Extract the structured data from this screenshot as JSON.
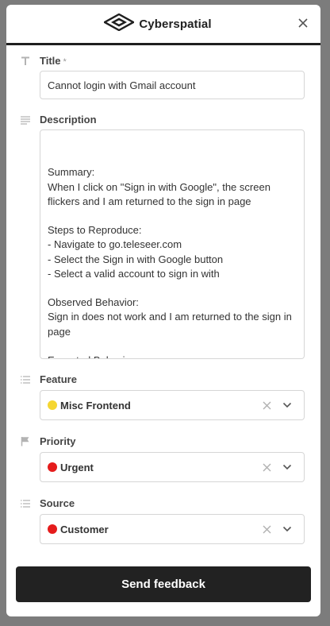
{
  "header": {
    "brand_name": "Cyberspatial"
  },
  "title_field": {
    "label": "Title",
    "required_mark": "*",
    "value": "Cannot login with Gmail account"
  },
  "description_field": {
    "label": "Description",
    "value": "Summary:\nWhen I click on \"Sign in with Google\", the screen flickers and I am returned to the sign in page\n\nSteps to Reproduce:\n- Navigate to go.teleseer.com\n- Select the Sign in with Google button\n- Select a valid account to sign in with\n\nObserved Behavior:\nSign in does not work and I am returned to the sign in page\n\nExpected Behavior:\nSign in works and the application loads"
  },
  "feature_field": {
    "label": "Feature",
    "value": "Misc Frontend",
    "color": "#f5d631"
  },
  "priority_field": {
    "label": "Priority",
    "value": "Urgent",
    "color": "#e51c1c"
  },
  "source_field": {
    "label": "Source",
    "value": "Customer",
    "color": "#e51c1c"
  },
  "footer": {
    "send_label": "Send feedback"
  },
  "icons": {
    "logo": "diamond-logo-icon",
    "close": "close-icon",
    "title": "text-t-icon",
    "description": "lines-icon",
    "feature": "list-icon",
    "priority": "flag-icon",
    "source": "list-icon",
    "attach": "paperclip-icon",
    "clear": "x-clear-icon",
    "dropdown": "chevron-down-icon"
  }
}
